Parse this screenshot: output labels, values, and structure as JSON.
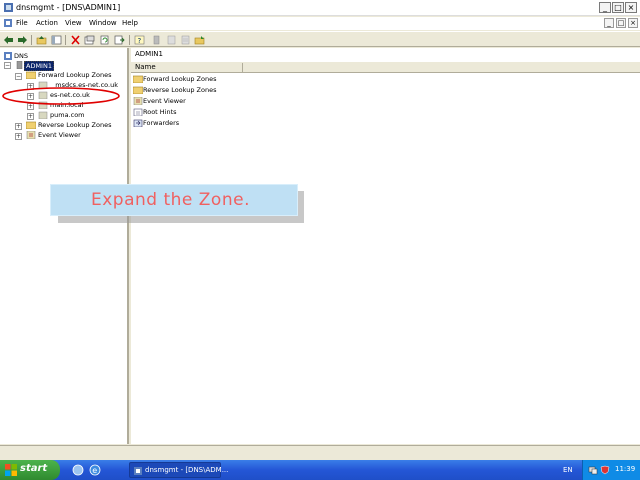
{
  "window": {
    "title": "dnsmgmt - [DNS\\ADMIN1]",
    "controls": [
      "_",
      "□",
      "×"
    ]
  },
  "menubar": {
    "items": [
      "File",
      "Action",
      "View",
      "Window",
      "Help"
    ],
    "mdi_controls": [
      "_",
      "□",
      "×"
    ]
  },
  "toolbar": {
    "icons": [
      "back-icon",
      "forward-icon",
      "up-folder-icon",
      "show-hide-tree-icon",
      "delete-icon",
      "properties-icon",
      "refresh-icon",
      "export-icon",
      "help-icon",
      "server-icon",
      "zone-icon",
      "record-icon",
      "folder-icon"
    ]
  },
  "tree": {
    "root": "DNS",
    "server": "ADMIN1",
    "forward_zones": "Forward Lookup Zones",
    "zones": [
      "_msdcs.es-net.co.uk",
      "es-net.co.uk",
      "main.local",
      "puma.com"
    ],
    "reverse_zones": "Reverse Lookup Zones",
    "event_viewer": "Event Viewer"
  },
  "right_pane": {
    "title": "ADMIN1",
    "column_header": "Name",
    "items": [
      "Forward Lookup Zones",
      "Reverse Lookup Zones",
      "Event Viewer",
      "Root Hints",
      "Forwarders"
    ]
  },
  "callout": {
    "text": "Expand the Zone."
  },
  "taskbar": {
    "start_label": "start",
    "task_label": "dnsmgmt - [DNS\\ADM...",
    "language": "EN",
    "clock": "11:39"
  },
  "colors": {
    "callout_bg": "#bfe0f4",
    "callout_text": "#f06060",
    "highlight_ellipse": "#e00000",
    "taskbar": "#2456d6"
  }
}
